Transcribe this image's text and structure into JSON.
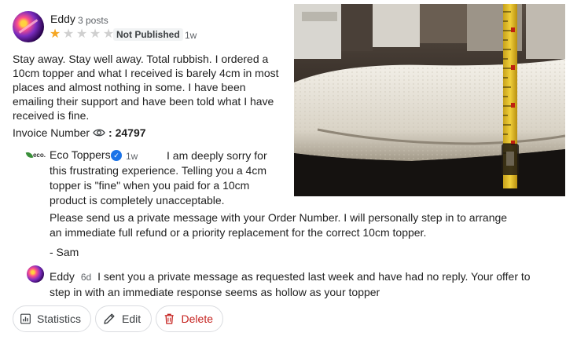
{
  "review": {
    "reviewer_name": "Eddy",
    "post_count": "3 posts",
    "rating": 1,
    "max_rating": 5,
    "status_badge": "Not Published",
    "age": "1w",
    "text": "Stay away. Stay well away. Total rubbish. I ordered a 10cm topper and what I received is barely 4cm in most places and almost nothing in some. I have been emailing their support and have been told what I have received is fine.",
    "invoice_label": "Invoice Number",
    "invoice_number": ": 24797"
  },
  "owner_reply": {
    "logo_text": "eco.",
    "name": "Eco Toppers",
    "age": "1w",
    "paragraph1": "I am deeply sorry for this frustrating experience. Telling you a 4cm topper is \"fine\" when you paid for a 10cm product is completely unacceptable.",
    "paragraph2": "Please send us a private message with your Order Number. I will personally step in to arrange an immediate full refund or a priority replacement for the correct 10cm topper.",
    "signature": "- Sam"
  },
  "followup": {
    "name": "Eddy",
    "age": "6d",
    "text": "I sent you a private message as requested last week and have had no reply. Your offer to step in with an immediate response seems as hollow as your topper"
  },
  "actions": {
    "statistics_label": "Statistics",
    "edit_label": "Edit",
    "delete_label": "Delete"
  },
  "colors": {
    "star_filled": "#f5a623",
    "verified_blue": "#1a73e8",
    "delete_red": "#c5221f"
  }
}
